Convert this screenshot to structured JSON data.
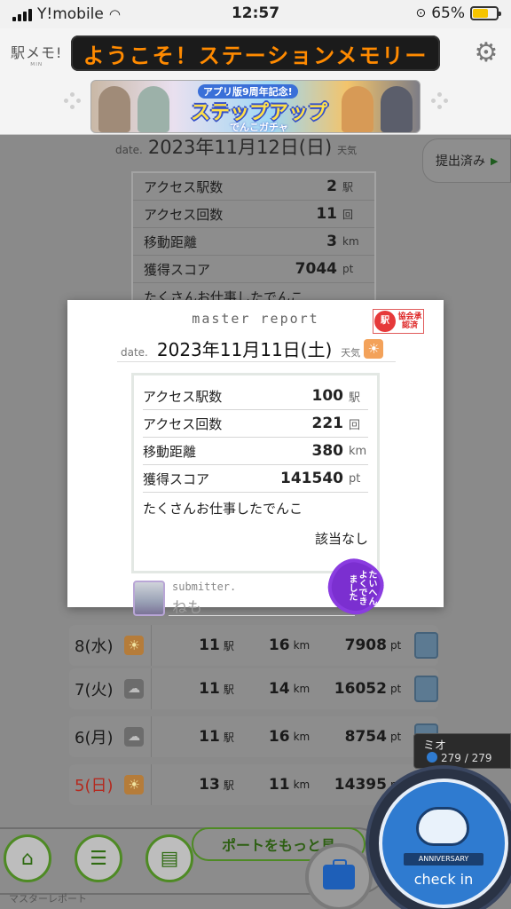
{
  "status_bar": {
    "carrier": "Y!mobile",
    "time": "12:57",
    "battery": "65%",
    "battery_level": 0.65
  },
  "header": {
    "logo_text": "駅メモ!",
    "logo_sub": "ᴹᴵᴺ",
    "marquee": "ようこそ！ステーションメモリー",
    "settings_icon": "gear-icon",
    "banner": {
      "line1": "アプリ版9周年記念!",
      "line2": "ステップアップ",
      "line3": "でんこガチャ"
    }
  },
  "background_report": {
    "date_label": "date.",
    "date_value": "2023年11月12日(日)",
    "weather_label": "天気",
    "stats": [
      {
        "label": "アクセス駅数",
        "value": "2",
        "unit": "駅"
      },
      {
        "label": "アクセス回数",
        "value": "11",
        "unit": "回"
      },
      {
        "label": "移動距離",
        "value": "3",
        "unit": "km"
      },
      {
        "label": "獲得スコア",
        "value": "7044",
        "unit": "pt"
      }
    ],
    "message_partial": "たくさんお仕事したでんこ",
    "submitted_tab": "提出済み"
  },
  "day_rows": [
    {
      "day": "8(水)",
      "weather": "sun",
      "stations": "11",
      "station_unit": "駅",
      "km": "16",
      "km_unit": "km",
      "points": "7908",
      "pt_unit": "pt",
      "holiday": false
    },
    {
      "day": "7(火)",
      "weather": "cloud",
      "stations": "11",
      "station_unit": "駅",
      "km": "14",
      "km_unit": "km",
      "points": "16052",
      "pt_unit": "pt",
      "holiday": false
    },
    {
      "day": "6(月)",
      "weather": "cloud",
      "stations": "11",
      "station_unit": "駅",
      "km": "16",
      "km_unit": "km",
      "points": "8754",
      "pt_unit": "pt",
      "holiday": false
    },
    {
      "day": "5(日)",
      "weather": "sun",
      "stations": "13",
      "station_unit": "駅",
      "km": "11",
      "km_unit": "km",
      "points": "14395",
      "pt_unit": "pt",
      "holiday": true
    }
  ],
  "modal": {
    "title": "master report",
    "badge_icon": "駅",
    "badge_text": "協会承認済",
    "date_label": "date.",
    "date_value": "2023年11月11日(土)",
    "weather_label": "天気",
    "weather_icon": "sun-icon",
    "stats": [
      {
        "label": "アクセス駅数",
        "value": "100",
        "unit": "駅"
      },
      {
        "label": "アクセス回数",
        "value": "221",
        "unit": "回"
      },
      {
        "label": "移動距離",
        "value": "380",
        "unit": "km"
      },
      {
        "label": "獲得スコア",
        "value": "141540",
        "unit": "pt"
      }
    ],
    "message": "たくさんお仕事したでんこ",
    "result": "該当なし",
    "submitter_label": "submitter.",
    "submitter_name": "ねも",
    "stamp_text": "たいへんよくできました"
  },
  "side_badge": {
    "name": "ミオ",
    "count": "279 / 279"
  },
  "bottom_nav": {
    "home_icon": "home-icon",
    "report_icon": "report-icon",
    "train_icon": "train-list-icon",
    "more_button": "ポートをもっと見",
    "label": "マスターレポート",
    "bag_icon": "briefcase-icon",
    "checkin_badge": "ANNIVERSARY",
    "checkin_label": "check in"
  },
  "colors": {
    "marquee_text": "#ff8a00",
    "accent_green": "#4e8a24",
    "checkin_blue": "#2f7bd0",
    "holiday_red": "#c0392b",
    "stamp_purple": "#7b2fd0"
  }
}
